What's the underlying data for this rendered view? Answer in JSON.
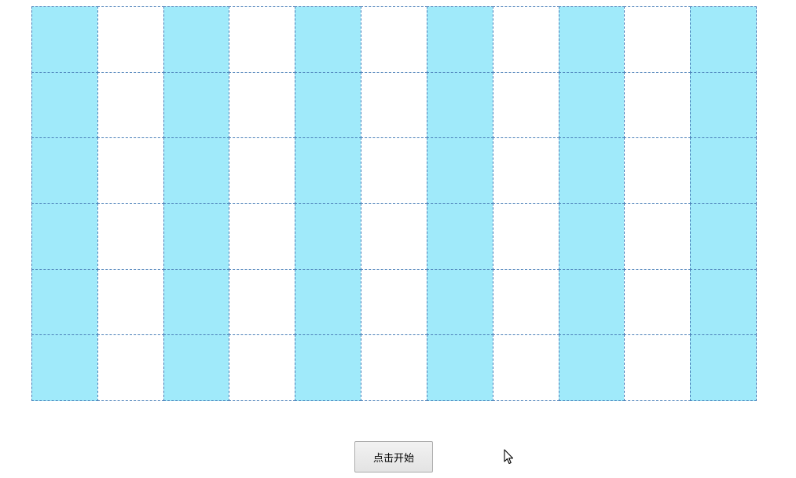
{
  "grid": {
    "rows": 6,
    "cols": 11,
    "pattern": "alternating-columns",
    "filled_columns": [
      0,
      2,
      4,
      6,
      8,
      10
    ],
    "fill_color": "#a0eafa",
    "empty_color": "#ffffff",
    "border_color": "#4a7fb8"
  },
  "start_button": {
    "label": "点击开始"
  },
  "cursor": {
    "icon": "mouse-pointer-icon"
  }
}
